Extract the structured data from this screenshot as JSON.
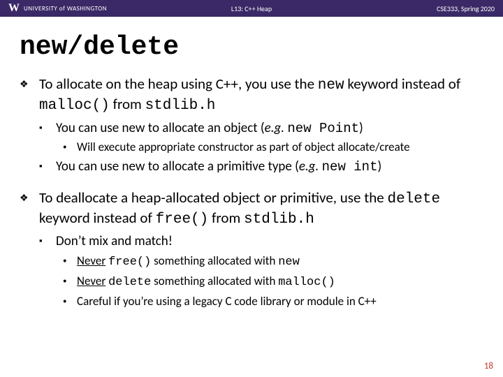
{
  "header": {
    "org": "UNIVERSITY of WASHINGTON",
    "lecture": "L13: C++ Heap",
    "course": "CSE333, Spring 2020"
  },
  "title": "new/delete",
  "b1": {
    "pre": "To allocate on the heap using C++, you use the ",
    "kw1": "new",
    "mid": " keyword instead of ",
    "kw2": "malloc()",
    "mid2": " from ",
    "kw3": "stdlib.h"
  },
  "b1s1": {
    "pre": "You can use new to allocate an object (",
    "eg": "e.g.",
    "sp": " ",
    "kw": "new Point",
    "post": ")"
  },
  "b1s1a": "Will execute appropriate constructor as part of object allocate/create",
  "b1s2": {
    "pre": "You can use new to allocate a primitive type (",
    "eg": "e.g.",
    "sp": " ",
    "kw": "new int",
    "post": ")"
  },
  "b2": {
    "pre": "To deallocate a heap-allocated object or primitive, use the ",
    "kw1": "delete",
    "mid": " keyword instead of ",
    "kw2": "free()",
    "mid2": " from ",
    "kw3": "stdlib.h"
  },
  "b2s1": "Don’t mix and match!",
  "b2s1a": {
    "u": "Never",
    "sp": " ",
    "kw": "free()",
    "mid": " something allocated with ",
    "kw2": "new"
  },
  "b2s1b": {
    "u": "Never",
    "sp": " ",
    "kw": "delete",
    "mid": " something allocated with ",
    "kw2": "malloc()"
  },
  "b2s1c": "Careful if you’re using a legacy C code library or module in C++",
  "page": "18"
}
